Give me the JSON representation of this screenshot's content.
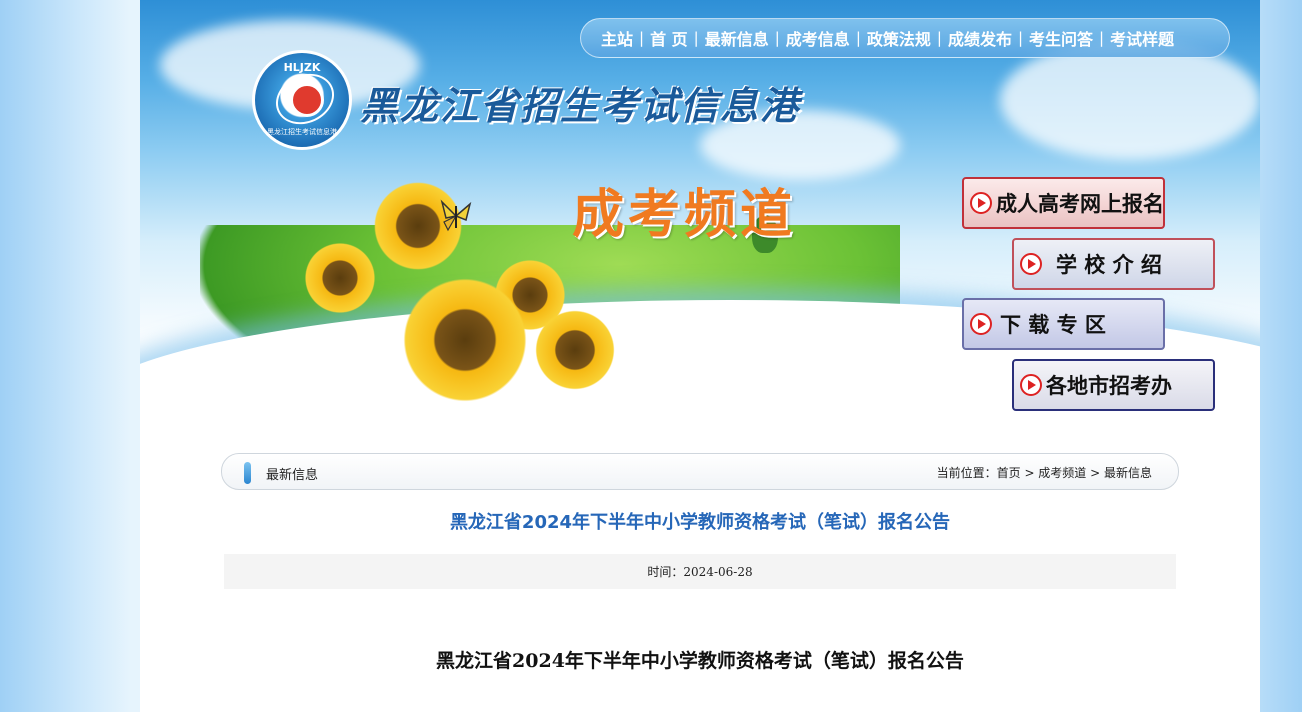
{
  "nav": {
    "items": [
      "主站",
      "首 页",
      "最新信息",
      "成考信息",
      "政策法规",
      "成绩发布",
      "考生问答",
      "考试样题"
    ],
    "separator": "|"
  },
  "logo": {
    "abbr": "HLJZK",
    "subtext": "黑龙江招生考试信息港"
  },
  "site_title": "黑龙江省招生考试信息港",
  "channel_title": "成考频道",
  "side_buttons": [
    {
      "label": "成人高考网上报名",
      "border": "#c0313a"
    },
    {
      "label": "学 校 介 绍",
      "border": "#c0505a"
    },
    {
      "label": "下 载 专 区",
      "border": "#6a6fa8"
    },
    {
      "label": "各地市招考办",
      "border": "#2a2f7a"
    }
  ],
  "breadcrumb": {
    "section": "最新信息",
    "location_prefix": "当前位置：",
    "path": "首页 > 成考频道 > 最新信息"
  },
  "article": {
    "title": "黑龙江省2024年下半年中小学教师资格考试（笔试）报名公告",
    "time_label": "时间：",
    "time_value": "2024-06-28",
    "body_heading": "黑龙江省2024年下半年中小学教师资格考试（笔试）报名公告"
  },
  "colors": {
    "accent_title": "#2667b8",
    "channel_orange": "#f07a20",
    "page_bg": "#e6f4fd"
  }
}
